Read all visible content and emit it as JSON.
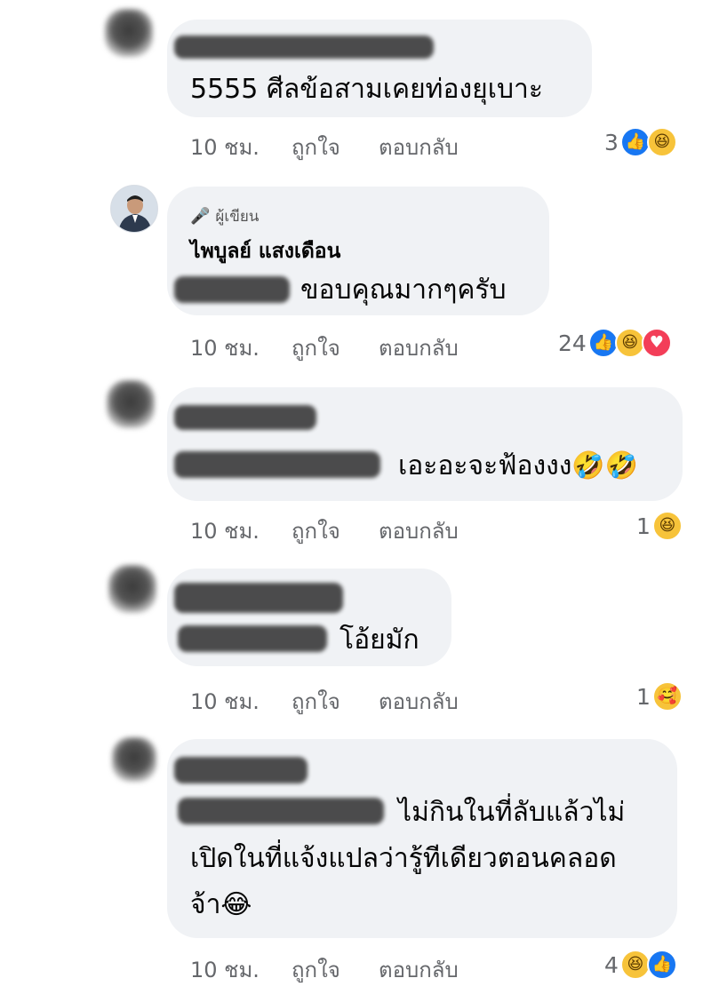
{
  "comments": [
    {
      "text": "5555 ศีลข้อสามเคยท่องยุเบาะ",
      "time": "10 ชม.",
      "like": "ถูกใจ",
      "reply": "ตอบกลับ",
      "reaction_count": "3",
      "reactions": [
        "like-icon",
        "haha-icon"
      ]
    },
    {
      "badge": "ผู้เขียน",
      "author": "ไพบูลย์ แสงเดือน",
      "text": "ขอบคุณมากๆครับ",
      "time": "10 ชม.",
      "like": "ถูกใจ",
      "reply": "ตอบกลับ",
      "reaction_count": "24",
      "reactions": [
        "like-icon",
        "haha-icon",
        "love-icon"
      ]
    },
    {
      "text": "เอะอะจะฟ้องงง🤣🤣",
      "time": "10 ชม.",
      "like": "ถูกใจ",
      "reply": "ตอบกลับ",
      "reaction_count": "1",
      "reactions": [
        "haha-icon"
      ]
    },
    {
      "text": "โอ้ยมัก",
      "time": "10 ชม.",
      "like": "ถูกใจ",
      "reply": "ตอบกลับ",
      "reaction_count": "1",
      "reactions": [
        "care-icon"
      ]
    },
    {
      "text_line1": "ไม่กินในที่ลับแล้วไม่",
      "text_line2": "เปิดในที่แจ้งแปลว่ารู้ทีเดียวตอนคลอด",
      "text_line3": "จ้า😂",
      "time": "10 ชม.",
      "like": "ถูกใจ",
      "reply": "ตอบกลับ",
      "reaction_count": "4",
      "reactions": [
        "haha-icon",
        "like-icon"
      ]
    }
  ],
  "colors": {
    "bubble": "#f0f2f5",
    "meta": "#65676b",
    "like": "#1877f2",
    "haha": "#f7c33a",
    "love": "#f33e58"
  }
}
